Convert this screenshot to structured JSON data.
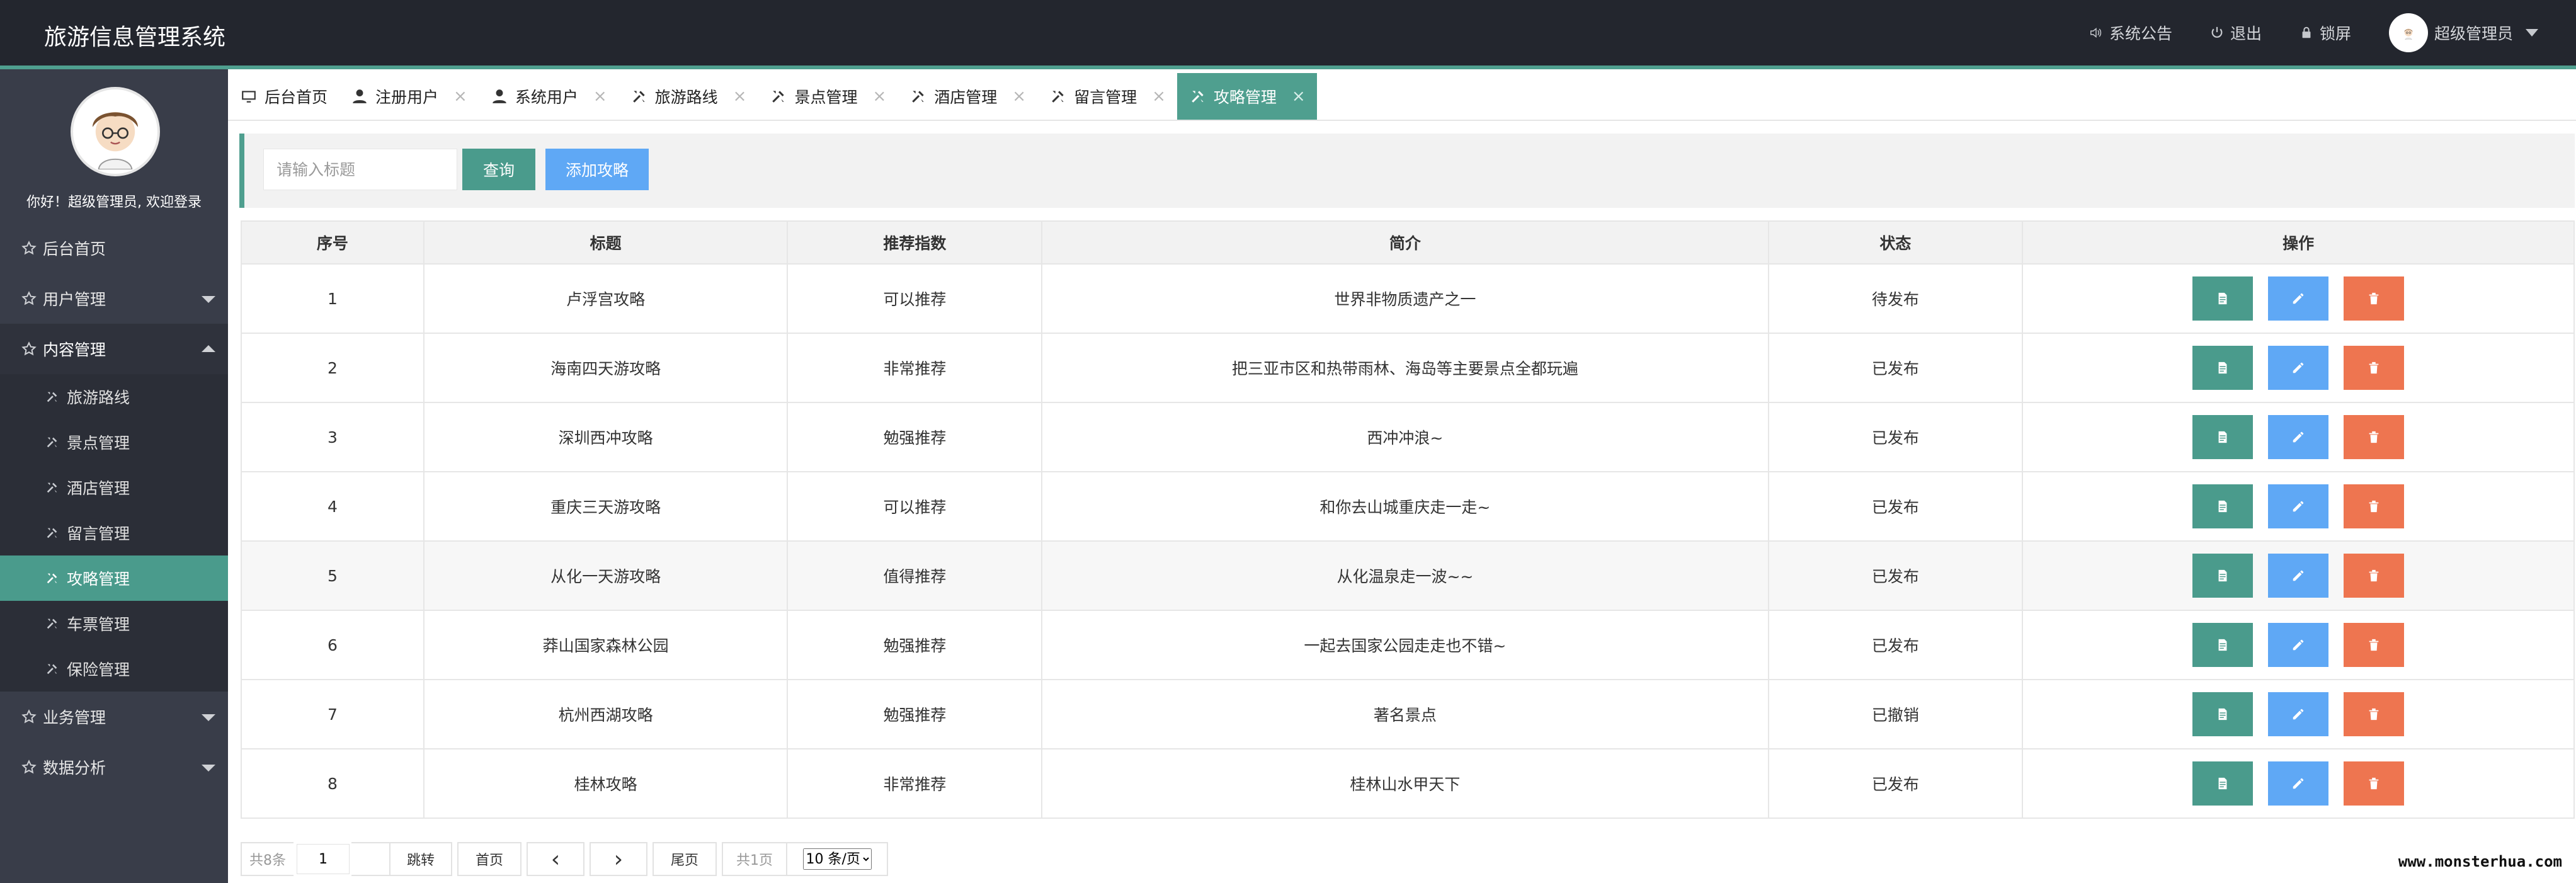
{
  "app": {
    "title": "旅游信息管理系统"
  },
  "header": {
    "notice": "系统公告",
    "logout": "退出",
    "lock": "锁屏",
    "user": "超级管理员"
  },
  "sidebar": {
    "welcome": "你好！超级管理员, 欢迎登录",
    "items": [
      {
        "label": "后台首页"
      },
      {
        "label": "用户管理"
      },
      {
        "label": "内容管理"
      },
      {
        "label": "业务管理"
      },
      {
        "label": "数据分析"
      }
    ],
    "content_sub": [
      {
        "label": "旅游路线"
      },
      {
        "label": "景点管理"
      },
      {
        "label": "酒店管理"
      },
      {
        "label": "留言管理"
      },
      {
        "label": "攻略管理"
      },
      {
        "label": "车票管理"
      },
      {
        "label": "保险管理"
      }
    ],
    "active_sub": "攻略管理"
  },
  "tabs": [
    {
      "label": "后台首页"
    },
    {
      "label": "注册用户"
    },
    {
      "label": "系统用户"
    },
    {
      "label": "旅游路线"
    },
    {
      "label": "景点管理"
    },
    {
      "label": "酒店管理"
    },
    {
      "label": "留言管理"
    },
    {
      "label": "攻略管理"
    }
  ],
  "active_tab": "攻略管理",
  "toolbar": {
    "search_placeholder": "请输入标题",
    "search_value": "",
    "query": "查询",
    "add": "添加攻略"
  },
  "table": {
    "headers": [
      "序号",
      "标题",
      "推荐指数",
      "简介",
      "状态",
      "操作"
    ],
    "rows": [
      [
        "1",
        "卢浮宫攻略",
        "可以推荐",
        "世界非物质遗产之一",
        "待发布"
      ],
      [
        "2",
        "海南四天游攻略",
        "非常推荐",
        "把三亚市区和热带雨林、海岛等主要景点全都玩遍",
        "已发布"
      ],
      [
        "3",
        "深圳西冲攻略",
        "勉强推荐",
        "西冲冲浪~",
        "已发布"
      ],
      [
        "4",
        "重庆三天游攻略",
        "可以推荐",
        "和你去山城重庆走一走~",
        "已发布"
      ],
      [
        "5",
        "从化一天游攻略",
        "值得推荐",
        "从化温泉走一波~~",
        "已发布"
      ],
      [
        "6",
        "莽山国家森林公园",
        "勉强推荐",
        "一起去国家公园走走也不错~",
        "已发布"
      ],
      [
        "7",
        "杭州西湖攻略",
        "勉强推荐",
        "著名景点",
        "已撤销"
      ],
      [
        "8",
        "桂林攻略",
        "非常推荐",
        "桂林山水甲天下",
        "已发布"
      ]
    ]
  },
  "pagination": {
    "total": "共8条",
    "page_value": "1",
    "jump": "跳转",
    "first": "首页",
    "prev": "‹",
    "next": "›",
    "last": "尾页",
    "pages": "共1页",
    "page_size": "10 条/页"
  },
  "watermark": "www.monsterhua.com",
  "colors": {
    "accent": "#4f9f8f",
    "primary": "#5fa8f5",
    "danger": "#ee7550",
    "header_bg": "#23262e",
    "sidebar_bg": "#393d49"
  }
}
